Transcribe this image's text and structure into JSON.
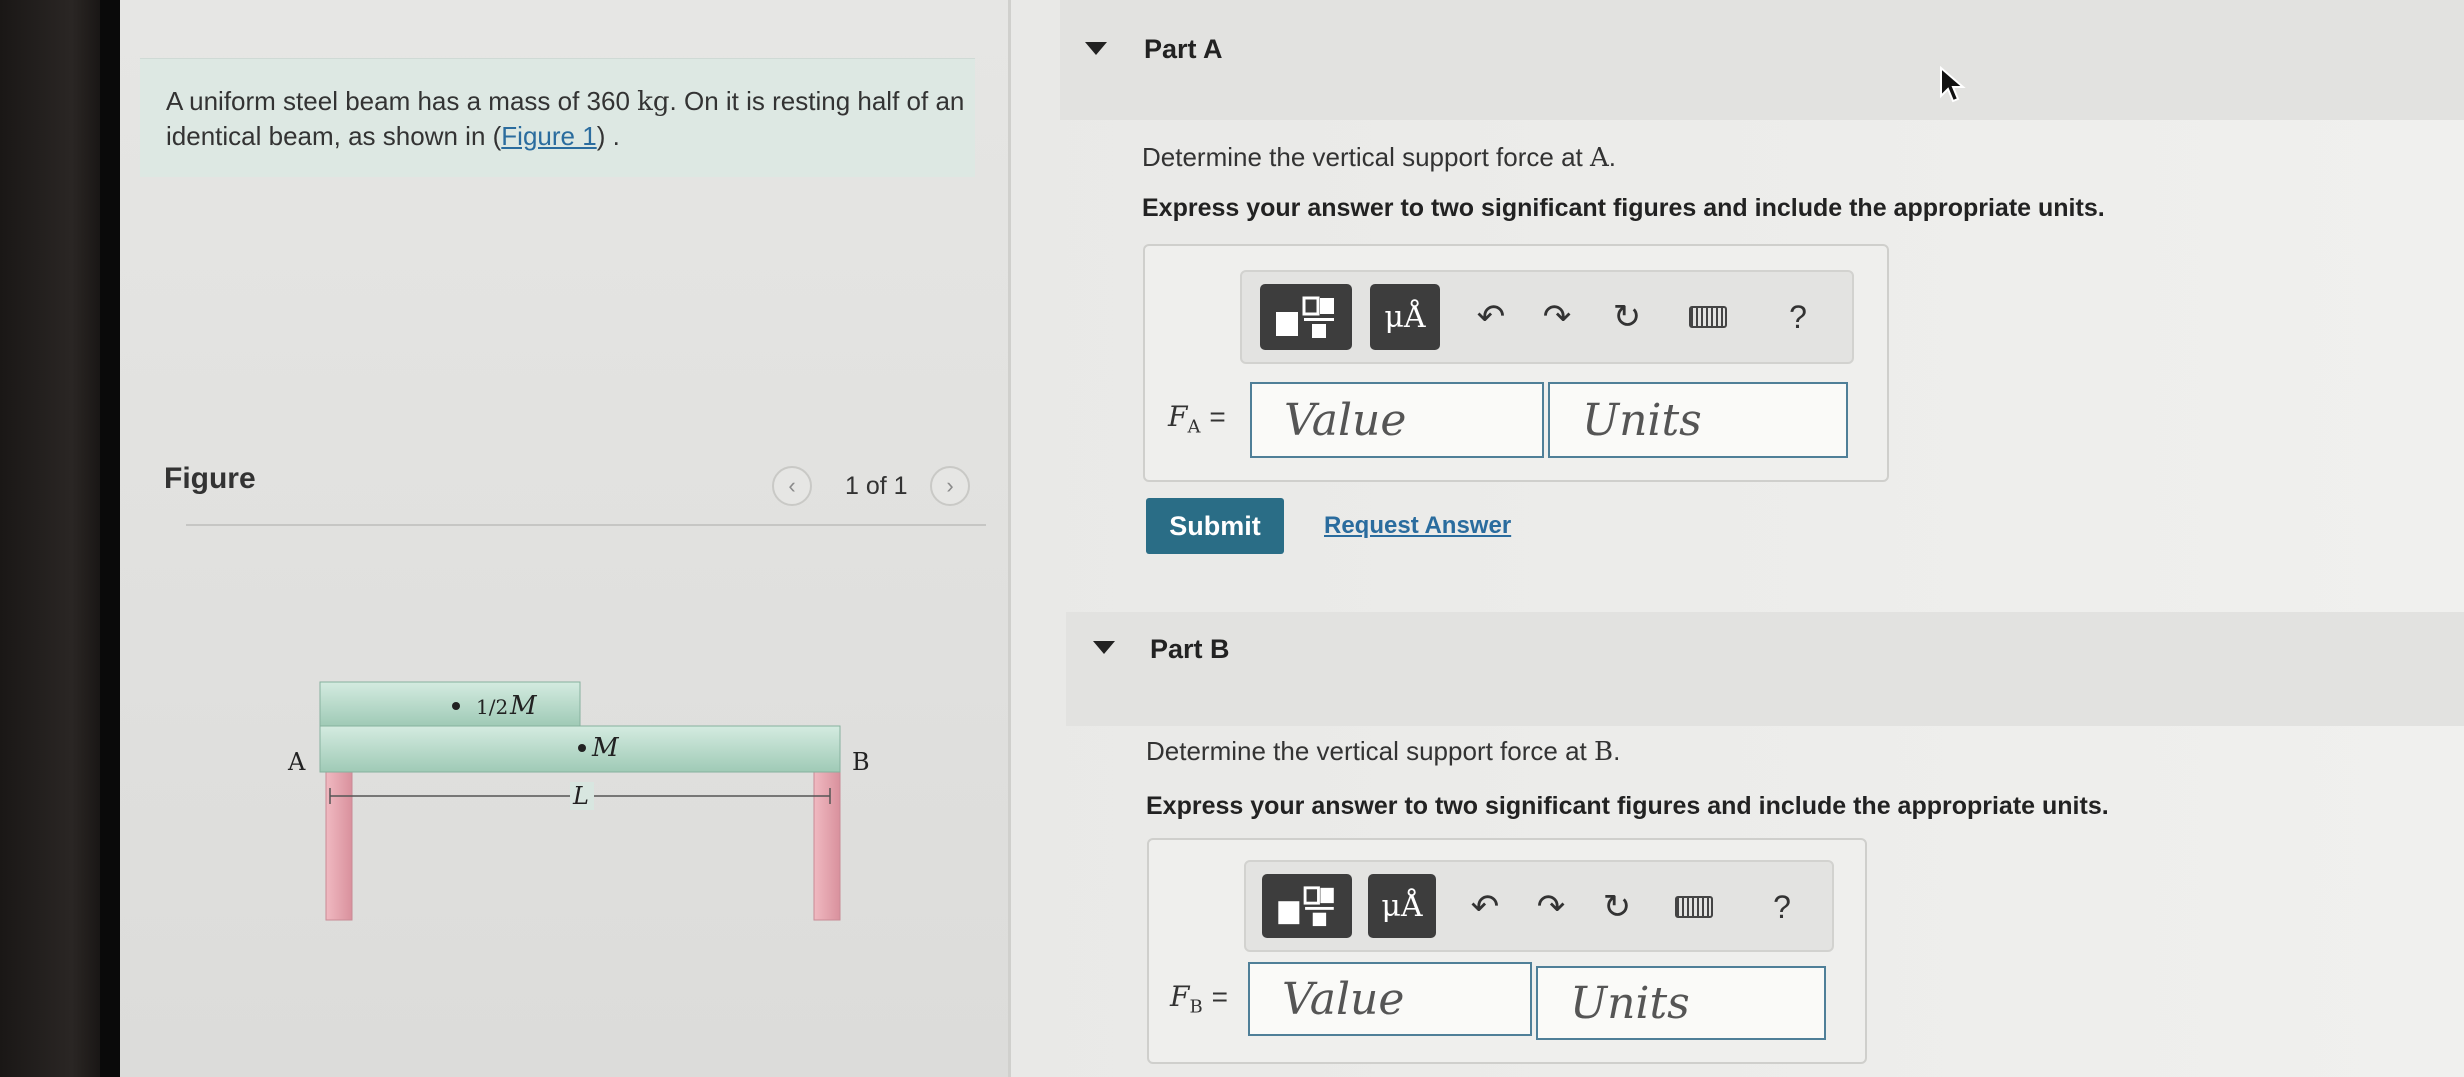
{
  "problem": {
    "text_before": "A uniform steel beam has a mass of 360 ",
    "mass_unit": "kg",
    "text_after": ". On it is resting half of an identical beam, as shown in (",
    "figure_link": "Figure 1",
    "text_end": ") ."
  },
  "figure": {
    "label": "Figure",
    "count": "1 of 1",
    "prev_icon": "chevron-left",
    "next_icon": "chevron-right",
    "labels": {
      "a": "A",
      "b": "B",
      "half_m_coef": "1/2",
      "half_m_var": "M",
      "m": "M",
      "l": "L"
    }
  },
  "part_a": {
    "title": "Part A",
    "question_before": "Determine the vertical support force at ",
    "question_point": "A",
    "question_after": ".",
    "instruction": "Express your answer to two significant figures and include the appropriate units.",
    "var_letter": "F",
    "var_sub": "A",
    "equals": "=",
    "value_placeholder": "Value",
    "units_placeholder": "Units",
    "submit_label": "Submit",
    "request_label": "Request Answer"
  },
  "part_b": {
    "title": "Part B",
    "question_before": "Determine the vertical support force at ",
    "question_point": "B",
    "question_after": ".",
    "instruction": "Express your answer to two significant figures and include the appropriate units.",
    "var_letter": "F",
    "var_sub": "B",
    "equals": "=",
    "value_placeholder": "Value",
    "units_placeholder": "Units"
  },
  "toolbar": {
    "units_label": "μÅ",
    "help_label": "?",
    "icons": [
      "templates-icon",
      "units-icon",
      "undo-icon",
      "redo-icon",
      "reset-icon",
      "keyboard-icon",
      "help-icon"
    ]
  },
  "colors": {
    "accent": "#2a6d86",
    "link": "#2a6c9e",
    "beam_top": "#d4ebe0",
    "support": "#e9a9b2"
  }
}
